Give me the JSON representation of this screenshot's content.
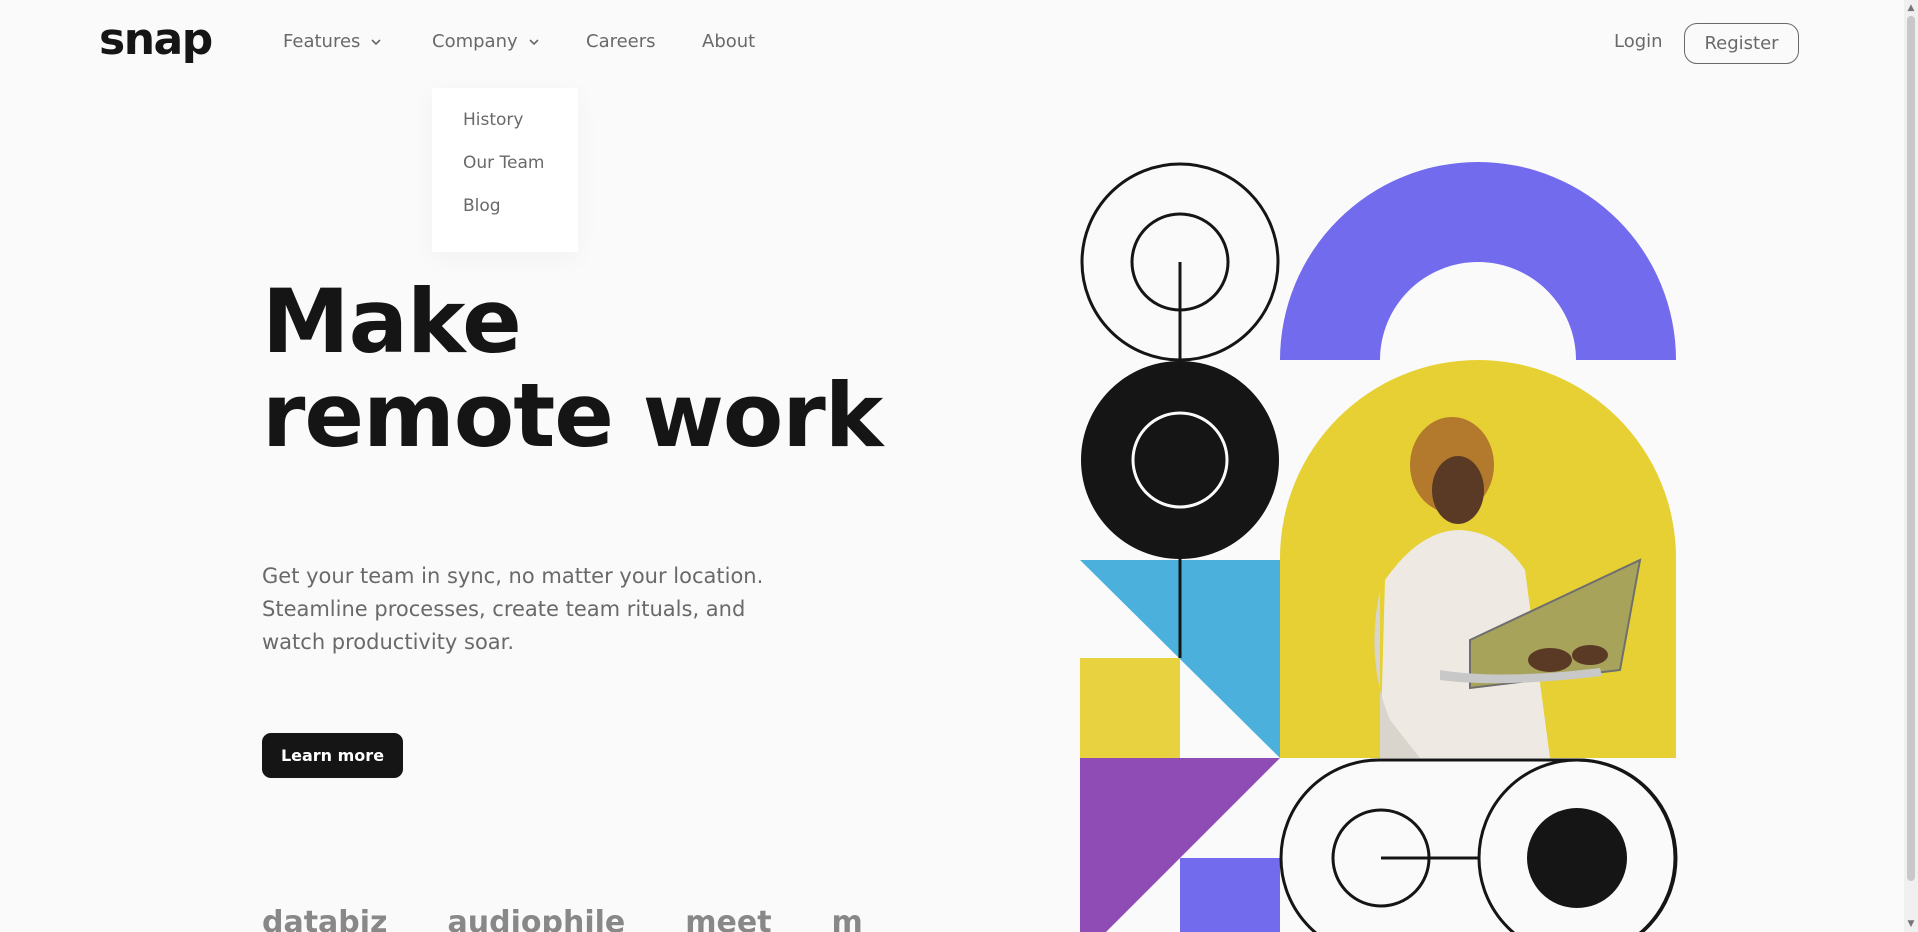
{
  "brand": {
    "logo": "snap"
  },
  "nav": {
    "features": "Features",
    "company": "Company",
    "careers": "Careers",
    "about": "About",
    "login": "Login",
    "register": "Register"
  },
  "company_menu": {
    "items": [
      "History",
      "Our Team",
      "Blog"
    ]
  },
  "hero": {
    "title_line1": "Make",
    "title_line2": "remote work",
    "body": "Get your team in sync, no matter your location. Steamline processes, create team rituals, and watch productivity soar.",
    "cta": "Learn more"
  },
  "clients": [
    "databiz",
    "audiophile",
    "meet",
    "maker"
  ],
  "colors": {
    "text_dark": "#151515",
    "text_gray": "#696969",
    "purple_arch": "#726bed",
    "yellow": "#e9d03a",
    "blue": "#4bb1dc",
    "violet": "#8f4cb5"
  }
}
